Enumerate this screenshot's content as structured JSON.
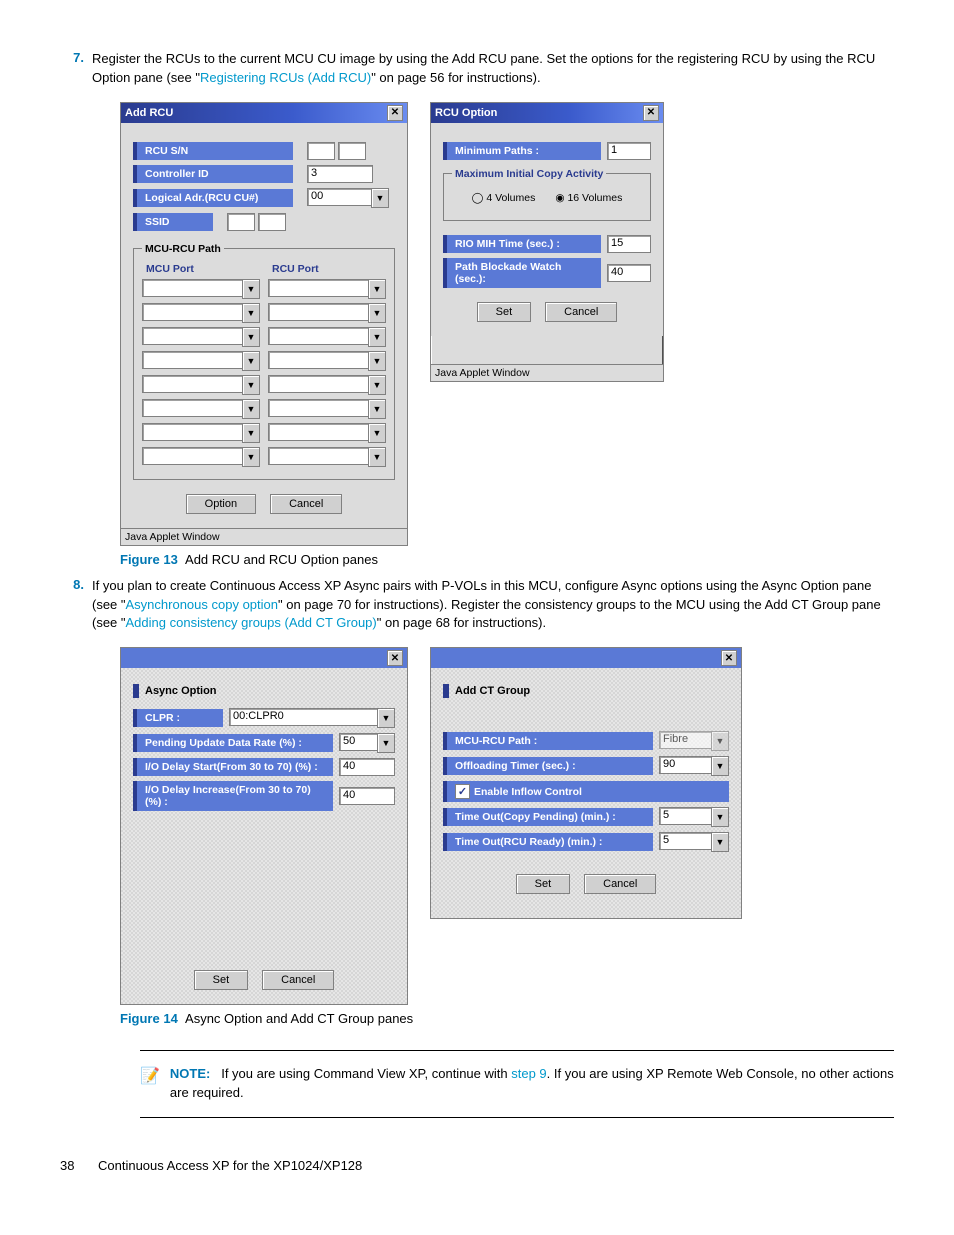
{
  "step7": {
    "num": "7.",
    "text_a": "Register the RCUs to the current MCU CU image by using the Add RCU pane. Set the options for the registering RCU by using the RCU Option pane (see \"",
    "link": "Registering RCUs (Add RCU)",
    "text_b": "\" on page 56 for instructions)."
  },
  "addRcu": {
    "title": "Add RCU",
    "sn": "RCU S/N",
    "ctrl": "Controller ID",
    "ctrl_val": "3",
    "logical": "Logical Adr.(RCU CU#)",
    "logical_val": "00",
    "ssid": "SSID",
    "pathLegend": "MCU-RCU Path",
    "mcuPort": "MCU Port",
    "rcuPort": "RCU Port",
    "option": "Option",
    "cancel": "Cancel",
    "status": "Java Applet Window"
  },
  "rcuOpt": {
    "title": "RCU Option",
    "minPaths": "Minimum Paths :",
    "minPaths_val": "1",
    "maxLegend": "Maximum Initial Copy Activity",
    "r4": "4 Volumes",
    "r16": "16 Volumes",
    "rio": "RIO MIH Time (sec.) :",
    "rio_val": "15",
    "block": "Path Blockade Watch (sec.):",
    "block_val": "40",
    "set": "Set",
    "cancel": "Cancel",
    "status": "Java Applet Window"
  },
  "fig13": {
    "label": "Figure 13",
    "caption": "Add RCU and RCU Option panes"
  },
  "step8": {
    "num": "8.",
    "text_a": "If you plan to create Continuous Access XP Async pairs with P-VOLs in this MCU, configure Async options using the Async Option pane (see \"",
    "link1": "Asynchronous copy option",
    "text_b": "\" on page 70 for instructions). Register the consistency groups to the MCU using the Add CT Group pane (see \"",
    "link2": "Adding consistency groups (Add CT Group)",
    "text_c": "\" on page 68 for instructions)."
  },
  "async": {
    "title": "Async Option",
    "clpr": "CLPR :",
    "clpr_val": "00:CLPR0",
    "pending": "Pending Update Data Rate (%) :",
    "pending_val": "50",
    "delayStart": "I/O Delay Start(From 30 to 70) (%) :",
    "delayStart_val": "40",
    "delayInc": "I/O Delay Increase(From 30 to 70) (%) :",
    "delayInc_val": "40",
    "set": "Set",
    "cancel": "Cancel"
  },
  "addCt": {
    "title": "Add CT Group",
    "path": "MCU-RCU Path :",
    "path_val": "Fibre",
    "off": "Offloading Timer (sec.) :",
    "off_val": "90",
    "inflow": "Enable Inflow Control",
    "tocp": "Time Out(Copy Pending) (min.) :",
    "tocp_val": "5",
    "torr": "Time Out(RCU Ready) (min.) :",
    "torr_val": "5",
    "set": "Set",
    "cancel": "Cancel"
  },
  "fig14": {
    "label": "Figure 14",
    "caption": "Async Option and Add CT Group panes"
  },
  "note": {
    "label": "NOTE:",
    "pre": "If you are using Command View XP, continue with ",
    "link": "step 9",
    "post": ". If you are using XP Remote Web Console, no other actions are required."
  },
  "footer": {
    "page": "38",
    "book": "Continuous Access XP for the XP1024/XP128"
  }
}
